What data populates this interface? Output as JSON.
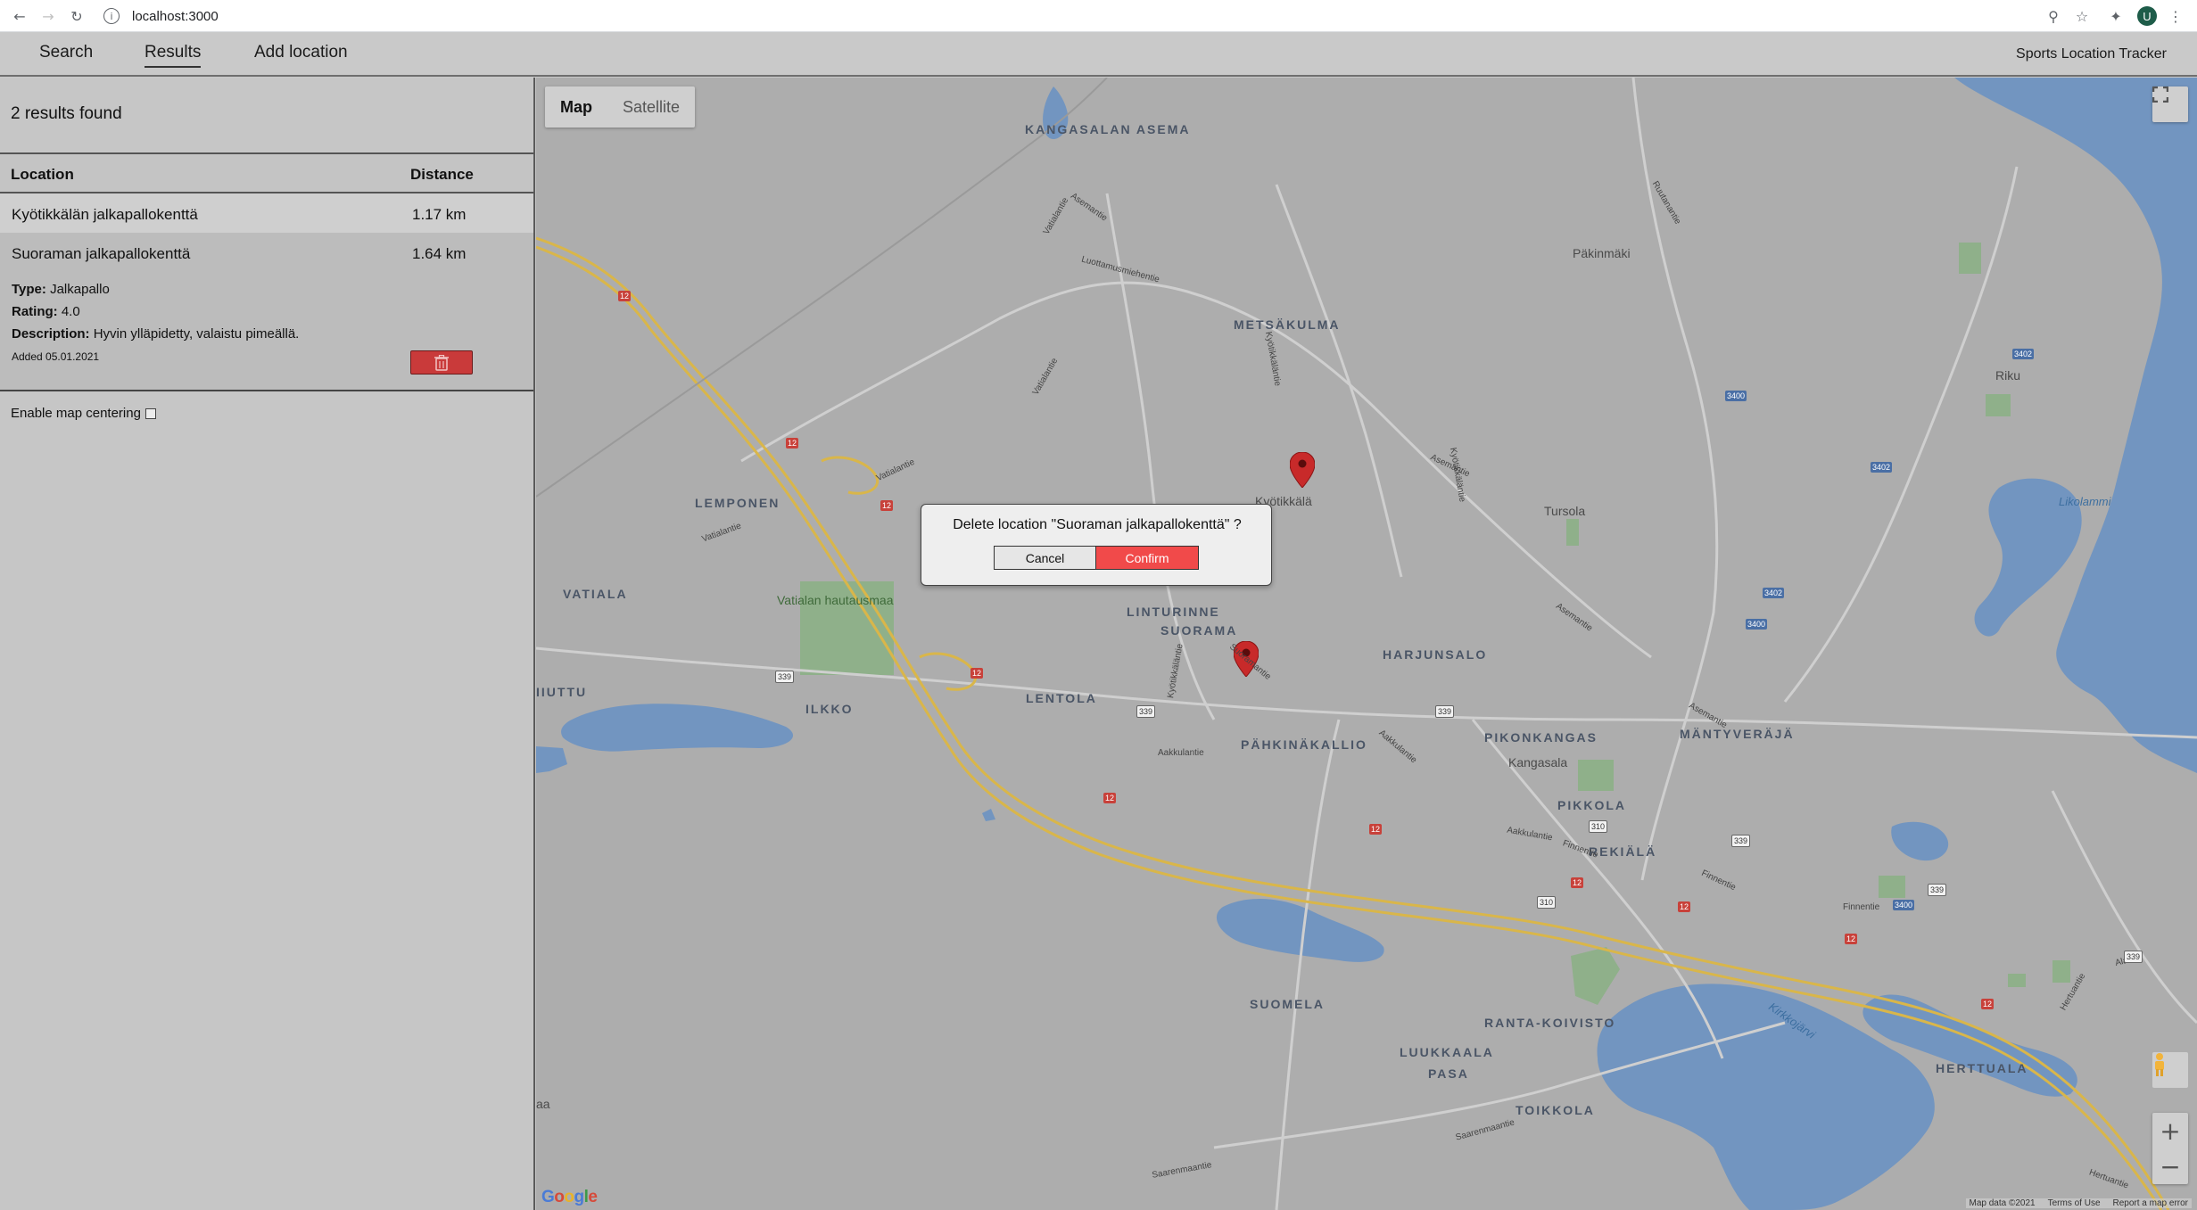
{
  "browser": {
    "url": "localhost:3000",
    "avatar_initial": "U"
  },
  "nav": {
    "items": [
      "Search",
      "Results",
      "Add location"
    ],
    "active": "Results",
    "app_title": "Sports Location Tracker"
  },
  "results": {
    "count_text": "2 results found",
    "columns": [
      "Location",
      "Distance"
    ],
    "rows": [
      {
        "location": "Kyötikkälän jalkapallokenttä",
        "distance": "1.17 km"
      },
      {
        "location": "Suoraman jalkapallokenttä",
        "distance": "1.64 km",
        "type_label": "Type:",
        "type": "Jalkapallo",
        "rating_label": "Rating:",
        "rating": "4.0",
        "description_label": "Description:",
        "description": "Hyvin ylläpidetty, valaistu pimeällä.",
        "added": "Added 05.01.2021"
      }
    ],
    "map_centering_label": "Enable map centering",
    "map_centering_checked": false
  },
  "map": {
    "type_buttons": [
      "Map",
      "Satellite"
    ],
    "active_type": "Map",
    "logo": "Google",
    "footer": [
      "Map data ©2021",
      "Terms of Use",
      "Report a map error"
    ],
    "places": [
      "KANGASALAN ASEMA",
      "METSÄKULMA",
      "LEMPONEN",
      "VATIALA",
      "LINTURINNE",
      "SUORAMA",
      "HARJUNSALO",
      "LENTOLA",
      "ILKKO",
      "IIUTTU",
      "PÄHKINÄKALLIO",
      "PIKONKANGAS",
      "MÄNTYVERÄJÄ",
      "PIKKOLA",
      "REKIÄLÄ",
      "SUOMELA",
      "RANTA-KOIVISTO",
      "LUUKKAALA",
      "PASA",
      "TOIKKOLA",
      "HERTTUALA"
    ],
    "small_places": [
      "Päkinmäki",
      "Kyötikkälä",
      "Tursola",
      "Vatialan hautausmaa",
      "Riku",
      "Kangasala",
      "aa"
    ],
    "water_labels": [
      "Likolammi",
      "Kirkkojärvi"
    ],
    "streets": [
      "Asemantie",
      "Vatialantie",
      "Luottamusmiehentie",
      "Kyötikkäläntie",
      "Suoramantie",
      "Aakkulantie",
      "Finnentie",
      "Saarenmaantie",
      "Hertuantie",
      "Alatie",
      "Ruutanantie"
    ],
    "road_numbers": [
      "12",
      "339",
      "310",
      "3400",
      "3402"
    ]
  },
  "dialog": {
    "message": "Delete location \"Suoraman jalkapallokenttä\" ?",
    "cancel": "Cancel",
    "confirm": "Confirm"
  },
  "colors": {
    "water": "#7295c0",
    "land": "#adadad",
    "park": "#8fb08a",
    "highway": "#d9b64a",
    "danger": "#f14a4a",
    "marker": "#c82a2a"
  }
}
